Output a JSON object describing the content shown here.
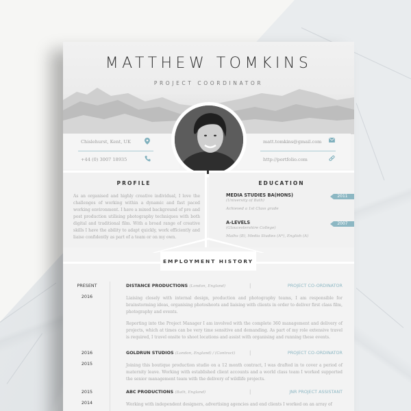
{
  "resume": {
    "name": "MATTHEW TOMKINS",
    "role": "PROJECT COORDINATOR",
    "contact": {
      "address": "Chislehurst, Kent, UK",
      "phone": "+44 (0) 3007 18935",
      "email": "matt.tomkins@gmail.com",
      "website": "http://portfolio.com",
      "icons": {
        "address": "map-pin-icon",
        "phone": "phone-icon",
        "email": "envelope-icon",
        "website": "link-icon"
      }
    },
    "profile": {
      "title": "PROFILE",
      "text": "As an organised and highly creative individual, I love the challenges of working within a dynamic and fast paced working environment. I have a mixed background of pre and post production utilising photography techniques with both digital and traditional film. With a broad range of creative skills I have the ability to adapt quickly, work efficiently and liaise confidently as part of a team or on my own."
    },
    "education": {
      "title": "EDUCATION",
      "items": [
        {
          "degree": "MEDIA STUDIES BA(HONS)",
          "school": "(University of Bath)",
          "note": "Achieved a 1st Class grade",
          "year": "2011"
        },
        {
          "degree": "A-LEVELS",
          "school": "(Gloucestershire College)",
          "note": "Maths (B), Media Studies (A*), English (A)",
          "year": "2007"
        }
      ]
    },
    "employment": {
      "title": "EMPLOYMENT HISTORY",
      "jobs": [
        {
          "date_end": "PRESENT",
          "date_start": "2016",
          "company": "DISTANCE PRODUCTIONS",
          "location": "(London, England)",
          "separator": "|",
          "position": "PROJECT CO-ORDINATOR",
          "desc1": "Liaising closely with internal design, production and photography teams, I am responsible for brainstorming ideas, organising photoshoots and liaising with clients in order to deliver first class film, photography and events.",
          "desc2": "Reporting into the Project Manager I am involved with the complete 360 management and delivery of projects, which at times can be very time sensitive and demanding.  As part of my role extensive travel is required, I travel onsite to shoot locations and assist with organising and running these events."
        },
        {
          "date_end": "2016",
          "date_start": "2015",
          "company": "GOLDRUN STUDIOS",
          "location": "(London, England) / (Contract)",
          "separator": "|",
          "position": "PROJECT CO-ORDINATOR",
          "desc1": "Joining this boutique production studio on a 12 month contract, I was drafted in to cover a period of maternity leave.  Working with established client accounts and a world class team I worked supported the senior management team with the delivery of wildlife projects."
        },
        {
          "date_end": "2015",
          "date_start": "2014",
          "company": "ABC PRODUCTIONS",
          "location": "(Bath, England)",
          "separator": "|",
          "position": "JNR PROJECT ASSISTANT",
          "desc1": "Working with independent designers, advertising agencies and end clients I worked on an array of"
        }
      ]
    }
  },
  "colors": {
    "accent": "#8cb7c3",
    "heading": "#333333",
    "body_text": "#a5a5a5",
    "sheet": "#f3f3f3",
    "background": "#f6f6f4"
  }
}
